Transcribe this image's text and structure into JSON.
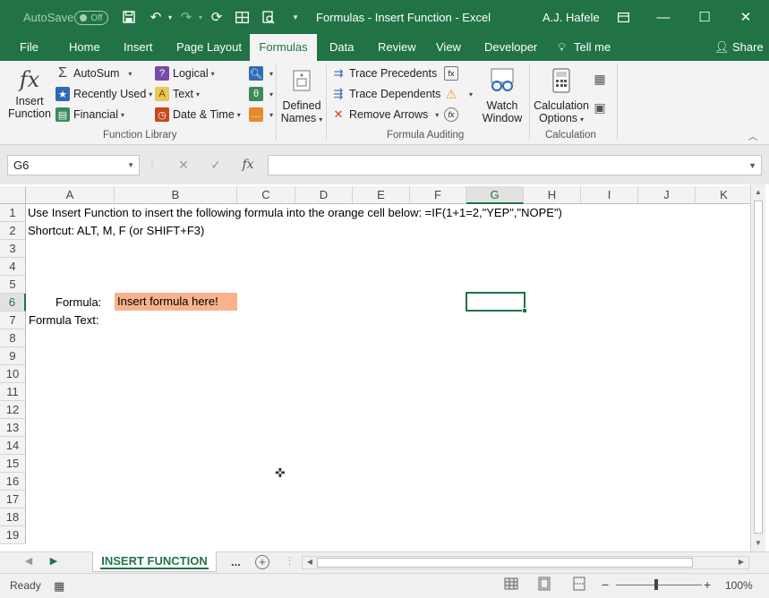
{
  "titlebar": {
    "autosave_label": "AutoSave",
    "autosave_state": "Off",
    "title": "Formulas - Insert Function  -  Excel",
    "user": "A.J. Hafele"
  },
  "tabs": [
    {
      "label": "File"
    },
    {
      "label": "Home"
    },
    {
      "label": "Insert"
    },
    {
      "label": "Page Layout"
    },
    {
      "label": "Formulas",
      "active": true
    },
    {
      "label": "Data"
    },
    {
      "label": "Review"
    },
    {
      "label": "View"
    },
    {
      "label": "Developer"
    },
    {
      "label": "Tell me"
    },
    {
      "label": "Share"
    }
  ],
  "ribbon": {
    "function_library": {
      "insert_function_line1": "Insert",
      "insert_function_line2": "Function",
      "autosum": "AutoSum",
      "recently_used": "Recently Used",
      "financial": "Financial",
      "logical": "Logical",
      "text": "Text",
      "date_time": "Date & Time",
      "group_label": "Function Library"
    },
    "defined_names": {
      "line1": "Defined",
      "line2": "Names"
    },
    "formula_auditing": {
      "trace_precedents": "Trace Precedents",
      "trace_dependents": "Trace Dependents",
      "remove_arrows": "Remove Arrows",
      "group_label": "Formula Auditing"
    },
    "watch_window": {
      "line1": "Watch",
      "line2": "Window"
    },
    "calculation": {
      "line1": "Calculation",
      "line2": "Options",
      "group_label": "Calculation"
    }
  },
  "formula_bar": {
    "name_box": "G6",
    "fx_label": "fx",
    "formula": ""
  },
  "grid": {
    "columns": [
      "A",
      "B",
      "C",
      "D",
      "E",
      "F",
      "G",
      "H",
      "I",
      "J",
      "K"
    ],
    "selected_column": "G",
    "rows": [
      "1",
      "2",
      "3",
      "4",
      "5",
      "6",
      "7",
      "8",
      "9",
      "10",
      "11",
      "12",
      "13",
      "14",
      "15",
      "16",
      "17",
      "18",
      "19"
    ],
    "selected_row": "6",
    "cells": {
      "A1": "Use Insert Function to insert the following formula into the orange cell below: =IF(1+1=2,\"YEP\",\"NOPE\")",
      "A2": "Shortcut: ALT, M, F (or SHIFT+F3)",
      "A6": "Formula:",
      "B6": "Insert formula here!",
      "A7": "Formula Text:"
    },
    "highlight_color": "#f8b38e"
  },
  "sheet_tabs": {
    "active": "INSERT FUNCTION",
    "more": "..."
  },
  "status": {
    "ready": "Ready",
    "zoom": "100%"
  },
  "colors": {
    "accent": "#217346"
  }
}
